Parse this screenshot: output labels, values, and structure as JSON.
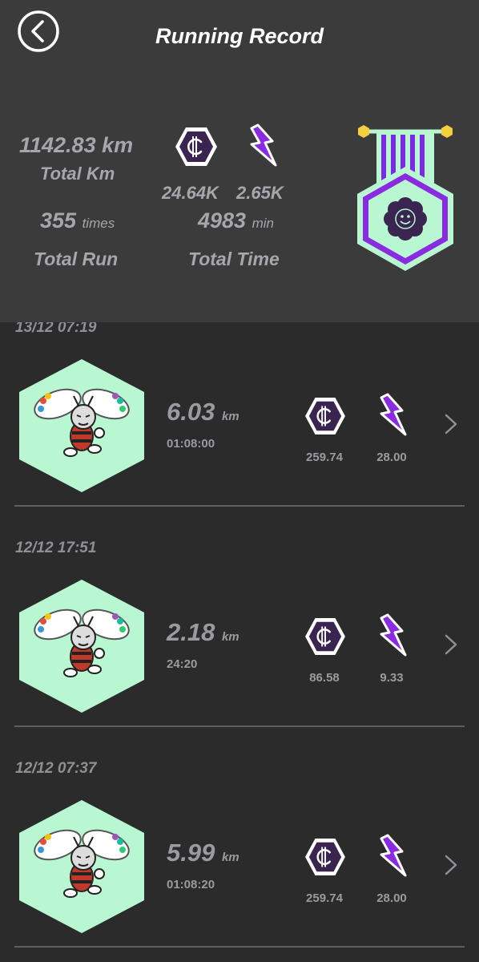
{
  "header": {
    "title": "Running Record",
    "total_km_value": "1142.83 km",
    "total_km_label": "Total Km",
    "total_run_count": "355",
    "total_run_unit": "times",
    "total_run_label": "Total Run",
    "token_total": "24.64K",
    "energy_total": "2.65K",
    "total_time_value": "4983",
    "total_time_unit": "min",
    "total_time_label": "Total Time"
  },
  "records": [
    {
      "date": "13/12 07:19",
      "distance": "6.03",
      "unit": "km",
      "duration": "01:08:00",
      "token": "259.74",
      "energy": "28.00"
    },
    {
      "date": "12/12 17:51",
      "distance": "2.18",
      "unit": "km",
      "duration": "24:20",
      "token": "86.58",
      "energy": "9.33"
    },
    {
      "date": "12/12 07:37",
      "distance": "5.99",
      "unit": "km",
      "duration": "01:08:20",
      "token": "259.74",
      "energy": "28.00"
    }
  ],
  "colors": {
    "background": "#2b2b2b",
    "header_bg": "#3b3b3b",
    "mint": "#b9f7d3",
    "purple": "#8a2be2",
    "dark_purple": "#3a2550",
    "gold": "#f4d03f"
  },
  "icons": [
    "back-icon",
    "coin-icon",
    "energy-bolt-icon",
    "medal-icon",
    "bee-avatar",
    "chevron-right-icon"
  ]
}
